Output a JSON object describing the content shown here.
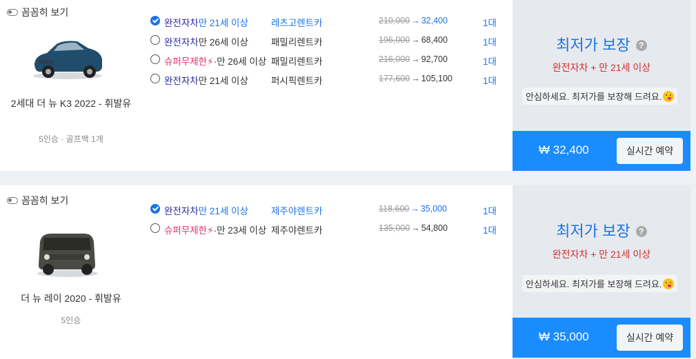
{
  "cards": [
    {
      "toggle_label": "꼼꼼히 보기",
      "car": {
        "name": "2세대 더 뉴 K3 2022 - 휘발유",
        "spec": "5인승 · 골프백 1개",
        "color": "#1f4d6b"
      },
      "options": [
        {
          "insurance": "완전자차",
          "bolt": "",
          "age": "만 21세 이상",
          "company": "레츠고렌트카",
          "orig_price": "210,000",
          "final_price": "32,400",
          "qty": "1대",
          "checked": true
        },
        {
          "insurance": "완전자차",
          "bolt": "",
          "age": "만 26세 이상",
          "company": "패밀리렌트카",
          "orig_price": "196,000",
          "final_price": "68,400",
          "qty": "1대",
          "checked": false
        },
        {
          "insurance": "슈퍼무제한",
          "bolt": "⚡",
          "age": "·만 26세 이상",
          "company": "패밀리렌트카",
          "orig_price": "216,000",
          "final_price": "92,700",
          "qty": "1대",
          "checked": false
        },
        {
          "insurance": "완전자차",
          "bolt": "",
          "age": "만 21세 이상",
          "company": "퍼시픽렌트카",
          "orig_price": "177,600",
          "final_price": "105,100",
          "qty": "1대",
          "checked": false
        }
      ],
      "lowest": {
        "title": "최저가 보장",
        "q": "?",
        "sub": "완전자차 + 만 21세 이상",
        "note": "안심하세요. 최저가를 보장해 드려요.",
        "total": "₩ 32,400",
        "reserve_label": "실시간 예약"
      }
    },
    {
      "toggle_label": "꼼꼼히 보기",
      "car": {
        "name": "더 뉴 레이 2020 - 휘발유",
        "spec": "5인승",
        "color": "#4a4a44"
      },
      "options": [
        {
          "insurance": "완전자차",
          "bolt": "",
          "age": "만 21세 이상",
          "company": "제주야렌트카",
          "orig_price": "118,600",
          "final_price": "35,000",
          "qty": "1대",
          "checked": true
        },
        {
          "insurance": "슈퍼무제한",
          "bolt": "⚡",
          "age": "·만 23세 이상",
          "company": "제주야렌트카",
          "orig_price": "135,000",
          "final_price": "54,800",
          "qty": "1대",
          "checked": false
        }
      ],
      "lowest": {
        "title": "최저가 보장",
        "q": "?",
        "sub": "완전자차 + 만 21세 이상",
        "note": "안심하세요. 최저가를 보장해 드려요.",
        "total": "₩ 35,000",
        "reserve_label": "실시간 예약"
      }
    }
  ]
}
